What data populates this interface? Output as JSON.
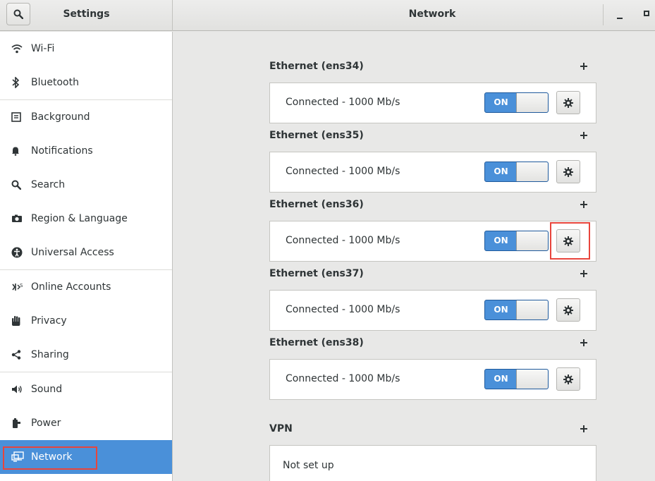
{
  "header": {
    "left_title": "Settings",
    "right_title": "Network"
  },
  "sidebar": {
    "items": [
      {
        "label": "Wi-Fi",
        "icon": "wifi-icon"
      },
      {
        "label": "Bluetooth",
        "icon": "bluetooth-icon"
      },
      {
        "label": "Background",
        "icon": "background-icon"
      },
      {
        "label": "Notifications",
        "icon": "bell-icon"
      },
      {
        "label": "Search",
        "icon": "search-icon"
      },
      {
        "label": "Region & Language",
        "icon": "camera-icon"
      },
      {
        "label": "Universal Access",
        "icon": "accessibility-icon"
      },
      {
        "label": "Online Accounts",
        "icon": "online-accounts-icon"
      },
      {
        "label": "Privacy",
        "icon": "hand-icon"
      },
      {
        "label": "Sharing",
        "icon": "share-icon"
      },
      {
        "label": "Sound",
        "icon": "speaker-icon"
      },
      {
        "label": "Power",
        "icon": "power-plug-icon"
      },
      {
        "label": "Network",
        "icon": "network-icon",
        "active": true
      }
    ]
  },
  "main": {
    "connections": [
      {
        "title": "Ethernet (ens34)",
        "status": "Connected - 1000 Mb/s",
        "switch": "ON"
      },
      {
        "title": "Ethernet (ens35)",
        "status": "Connected - 1000 Mb/s",
        "switch": "ON"
      },
      {
        "title": "Ethernet (ens36)",
        "status": "Connected - 1000 Mb/s",
        "switch": "ON"
      },
      {
        "title": "Ethernet (ens37)",
        "status": "Connected - 1000 Mb/s",
        "switch": "ON"
      },
      {
        "title": "Ethernet (ens38)",
        "status": "Connected - 1000 Mb/s",
        "switch": "ON"
      }
    ],
    "vpn": {
      "title": "VPN",
      "status": "Not set up"
    }
  },
  "colors": {
    "accent": "#4a90d9",
    "highlight": "#e8453c"
  }
}
